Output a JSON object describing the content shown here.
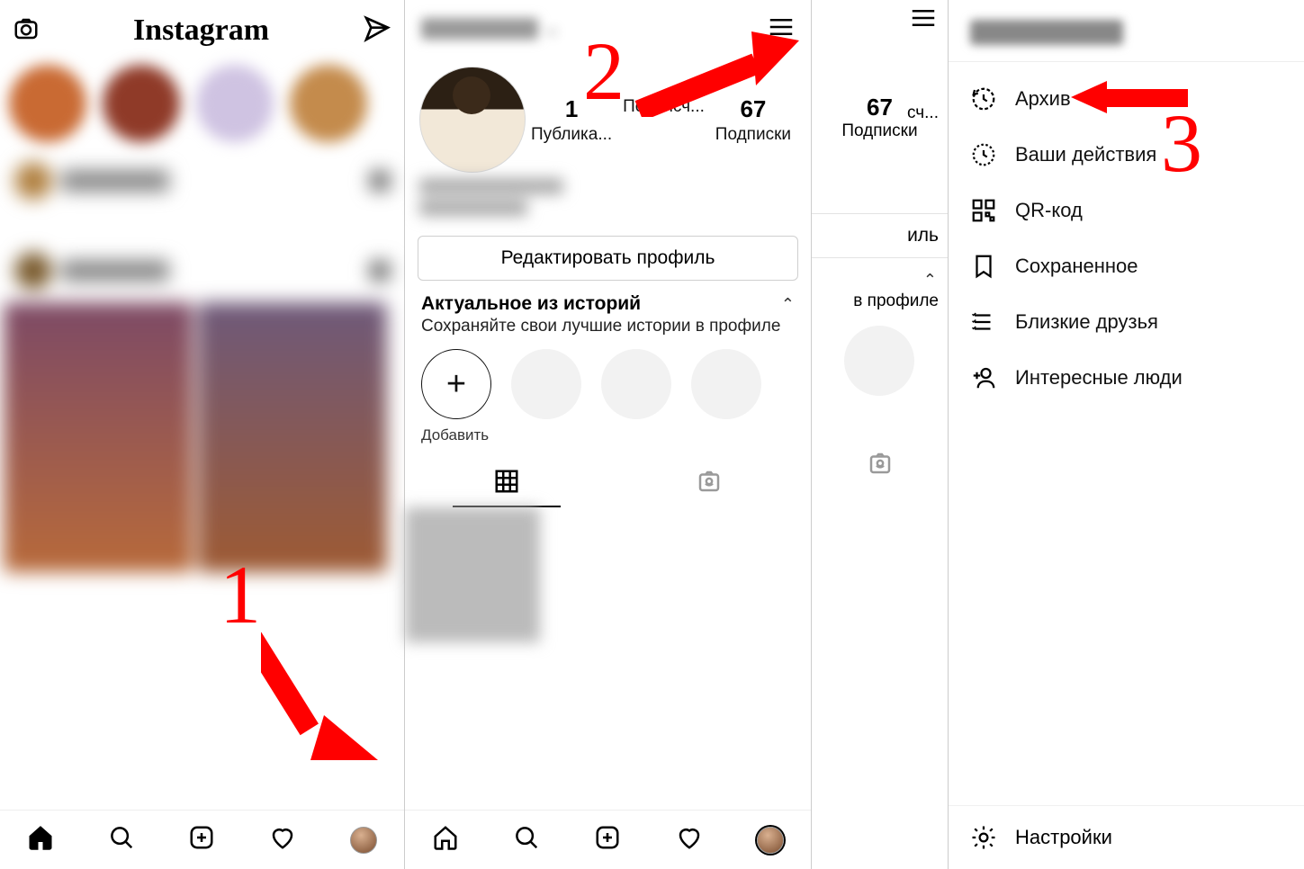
{
  "app": {
    "logo_text": "Instagram"
  },
  "profile": {
    "stats": {
      "posts_count": "1",
      "posts_label": "Публика...",
      "followers_count": "",
      "followers_label": "Подписч...",
      "following_count": "67",
      "following_label": "Подписки"
    },
    "edit_button": "Редактировать профиль",
    "highlights": {
      "title": "Актуальное из историй",
      "subtitle": "Сохраняйте свои лучшие истории в профиле",
      "add_label": "Добавить"
    }
  },
  "panel3": {
    "following_count": "67",
    "following_label": "Подписки",
    "edit_suffix": "иль",
    "followers_suffix": "сч...",
    "sub_suffix": "в профиле"
  },
  "menu": {
    "items": [
      {
        "label": "Архив"
      },
      {
        "label": "Ваши действия"
      },
      {
        "label": "QR-код"
      },
      {
        "label": "Сохраненное"
      },
      {
        "label": "Близкие друзья"
      },
      {
        "label": "Интересные люди"
      }
    ],
    "settings": "Настройки"
  },
  "annotations": {
    "num1": "1",
    "num2": "2",
    "num3": "3"
  }
}
